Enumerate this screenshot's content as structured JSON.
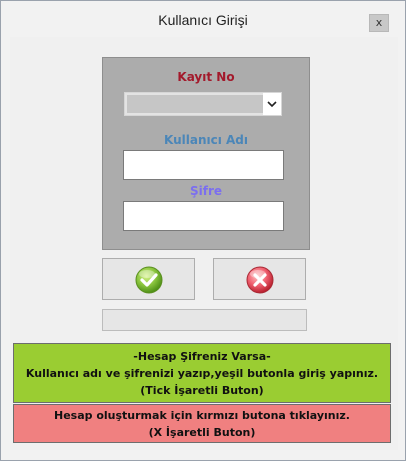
{
  "window": {
    "title": "Kullanıcı Girişi",
    "close_label": "x"
  },
  "form": {
    "record_label": "Kayıt No",
    "record_value": "",
    "username_label": "Kullanıcı Adı",
    "username_value": "",
    "password_label": "Şifre",
    "password_value": ""
  },
  "buttons": {
    "confirm_icon": "green-check-icon",
    "cancel_icon": "red-x-icon"
  },
  "progress": {
    "value": 0
  },
  "info": {
    "green_lines": [
      "-Hesap Şifreniz Varsa-",
      "Kullanıcı adı ve şifrenizi yazıp,yeşil butonla giriş yapınız.",
      "(Tick İşaretli Buton)"
    ],
    "red_lines": [
      "Hesap oluşturmak için kırmızı butona tıklayınız.",
      "(X İşaretli Buton)"
    ]
  },
  "colors": {
    "record_label": "#a3192b",
    "username_label": "#4b86b8",
    "password_label": "#7b6ef0",
    "info_green": "#9acd32",
    "info_red": "#f08080"
  }
}
